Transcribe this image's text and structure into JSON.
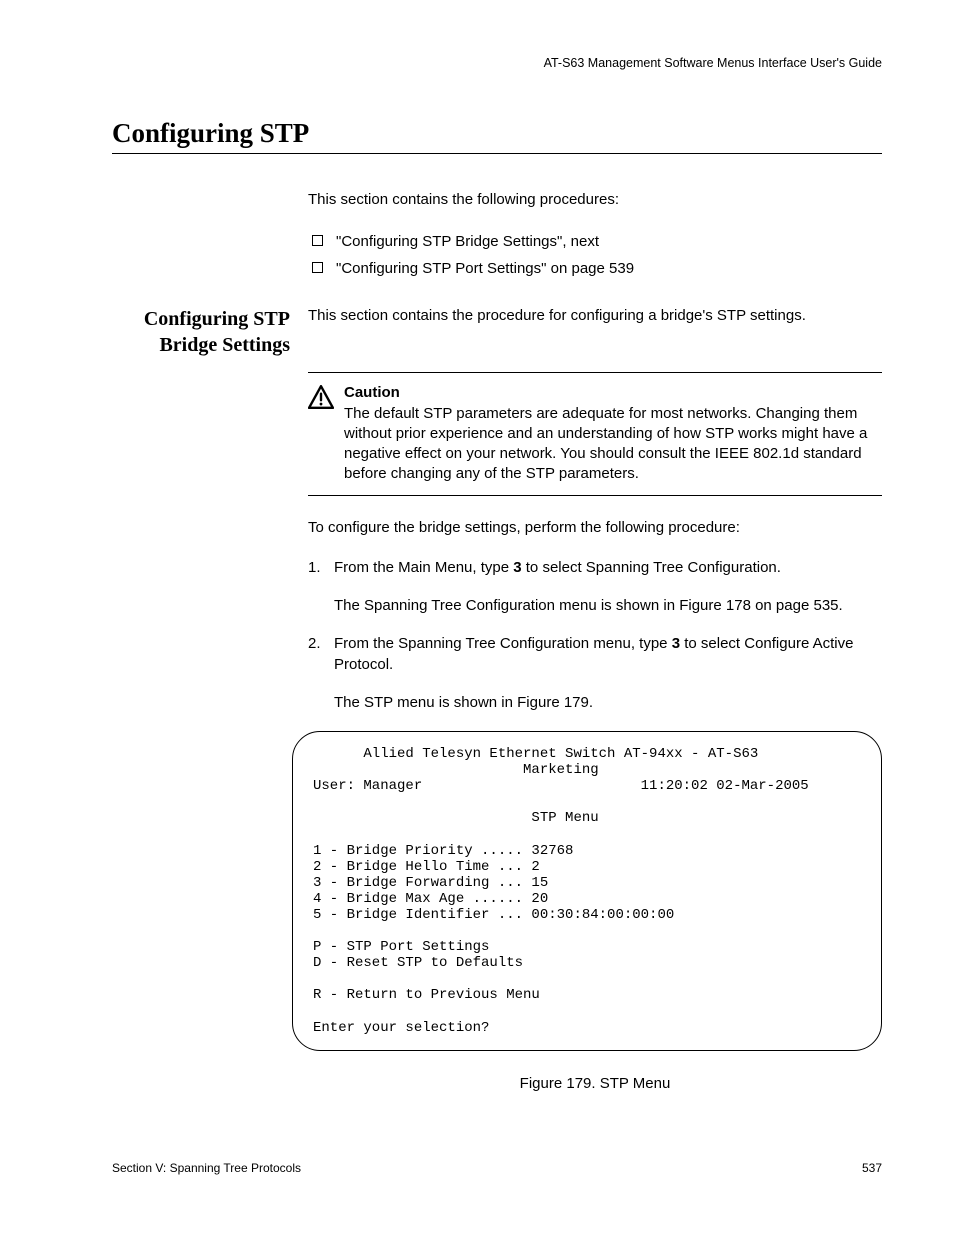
{
  "header": "AT-S63 Management Software Menus Interface User's Guide",
  "section_title": "Configuring STP",
  "intro": "This section contains the following procedures:",
  "bullets": [
    "\"Configuring STP Bridge Settings\", next",
    "\"Configuring STP Port Settings\" on page 539"
  ],
  "side_heading": "Configuring STP Bridge Settings",
  "side_intro": "This section contains the procedure for configuring a bridge's STP settings.",
  "caution": {
    "head": "Caution",
    "body": "The default STP parameters are adequate for most networks. Changing them without prior experience and an understanding of how STP works might have a negative effect on your network. You should consult the IEEE 802.1d standard before changing any of the STP parameters."
  },
  "lead": "To configure the bridge settings, perform the following procedure:",
  "steps": [
    {
      "num": "1.",
      "main_pre": "From the Main Menu, type ",
      "main_bold": "3",
      "main_post": " to select Spanning Tree Configuration.",
      "sub": "The Spanning Tree Configuration menu is shown in Figure 178 on page 535."
    },
    {
      "num": "2.",
      "main_pre": "From the Spanning Tree Configuration menu, type ",
      "main_bold": "3",
      "main_post": " to select Configure Active Protocol.",
      "sub": "The STP menu is shown in Figure 179."
    }
  ],
  "terminal": "      Allied Telesyn Ethernet Switch AT-94xx - AT-S63\n                         Marketing\nUser: Manager                          11:20:02 02-Mar-2005\n\n                          STP Menu\n\n1 - Bridge Priority ..... 32768\n2 - Bridge Hello Time ... 2\n3 - Bridge Forwarding ... 15\n4 - Bridge Max Age ...... 20\n5 - Bridge Identifier ... 00:30:84:00:00:00\n\nP - STP Port Settings\nD - Reset STP to Defaults\n\nR - Return to Previous Menu\n\nEnter your selection?",
  "figure_caption": "Figure 179. STP Menu",
  "footer_left": "Section V: Spanning Tree Protocols",
  "footer_right": "537"
}
